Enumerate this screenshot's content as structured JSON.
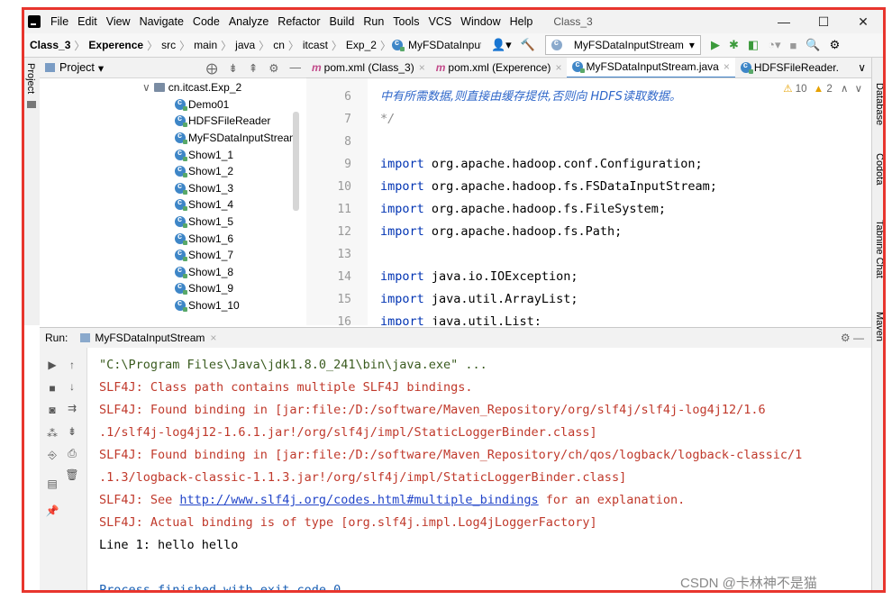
{
  "menu": {
    "items": [
      "File",
      "Edit",
      "View",
      "Navigate",
      "Code",
      "Analyze",
      "Refactor",
      "Build",
      "Run",
      "Tools",
      "VCS",
      "Window",
      "Help"
    ],
    "window_title": "Class_3",
    "controls": [
      "—",
      "☐",
      "✕"
    ]
  },
  "nav": {
    "breadcrumbs": [
      "Class_3",
      "Experence",
      "src",
      "main",
      "java",
      "cn",
      "itcast",
      "Exp_2",
      "MyFSDataInputStream"
    ],
    "run_config": "MyFSDataInputStream"
  },
  "project": {
    "title": "Project",
    "package": "cn.itcast.Exp_2",
    "files": [
      "Demo01",
      "HDFSFileReader",
      "MyFSDataInputStream",
      "Show1_1",
      "Show1_2",
      "Show1_3",
      "Show1_4",
      "Show1_5",
      "Show1_6",
      "Show1_7",
      "Show1_8",
      "Show1_9",
      "Show1_10"
    ]
  },
  "tabs": [
    {
      "label": "pom.xml (Class_3)",
      "icon": "maven"
    },
    {
      "label": "pom.xml (Experence)",
      "icon": "maven"
    },
    {
      "label": "MyFSDataInputStream.java",
      "icon": "class",
      "active": true
    },
    {
      "label": "HDFSFileReader.",
      "icon": "class"
    }
  ],
  "editor": {
    "inspection": {
      "warnings": "10",
      "weak_warnings": "2"
    },
    "lines": [
      {
        "n": "6",
        "text": "中有所需数据,则直接由缓存提供,否则向 HDFS读取数据。",
        "kind": "doc"
      },
      {
        "n": "7",
        "text": "*/",
        "kind": "comment"
      },
      {
        "n": "8",
        "text": "",
        "kind": "plain"
      },
      {
        "n": "9",
        "kw": "import",
        "text": " org.apache.hadoop.conf.Configuration;",
        "kind": "import"
      },
      {
        "n": "10",
        "kw": "import",
        "text": " org.apache.hadoop.fs.FSDataInputStream;",
        "kind": "import"
      },
      {
        "n": "11",
        "kw": "import",
        "text": " org.apache.hadoop.fs.FileSystem;",
        "kind": "import"
      },
      {
        "n": "12",
        "kw": "import",
        "text": " org.apache.hadoop.fs.Path;",
        "kind": "import"
      },
      {
        "n": "13",
        "text": "",
        "kind": "plain"
      },
      {
        "n": "14",
        "kw": "import",
        "text": " java.io.IOException;",
        "kind": "import"
      },
      {
        "n": "15",
        "kw": "import",
        "text": " java.util.ArrayList;",
        "kind": "import"
      },
      {
        "n": "16",
        "kw": "import",
        "text": " java.util.List;",
        "kind": "import"
      }
    ]
  },
  "right_tools": [
    "Database",
    "Codota",
    "Tabnine Chat",
    "Maven"
  ],
  "run": {
    "label": "Run:",
    "tab": "MyFSDataInputStream",
    "lines": [
      {
        "text": "\"C:\\Program Files\\Java\\jdk1.8.0_241\\bin\\java.exe\" ...",
        "cls": "olive"
      },
      {
        "text": "SLF4J: Class path contains multiple SLF4J bindings.",
        "cls": "red"
      },
      {
        "text": "SLF4J: Found binding in [jar:file:/D:/software/Maven_Repository/org/slf4j/slf4j-log4j12/1.6",
        "cls": "red"
      },
      {
        "text": " .1/slf4j-log4j12-1.6.1.jar!/org/slf4j/impl/StaticLoggerBinder.class]",
        "cls": "red"
      },
      {
        "text": "SLF4J: Found binding in [jar:file:/D:/software/Maven_Repository/ch/qos/logback/logback-classic/1",
        "cls": "red"
      },
      {
        "text": " .1.3/logback-classic-1.1.3.jar!/org/slf4j/impl/StaticLoggerBinder.class]",
        "cls": "red"
      },
      {
        "text": "SLF4J: See ",
        "link": "http://www.slf4j.org/codes.html#multiple_bindings",
        "after": " for an explanation.",
        "cls": "red"
      },
      {
        "text": "SLF4J: Actual binding is of type [org.slf4j.impl.Log4jLoggerFactory]",
        "cls": "red"
      },
      {
        "text": "Line 1: hello hello",
        "cls": "plain"
      },
      {
        "text": "",
        "cls": "plain"
      },
      {
        "text": "Process finished with exit code 0",
        "cls": "blue"
      }
    ]
  },
  "watermark": "CSDN @卡林神不是猫"
}
